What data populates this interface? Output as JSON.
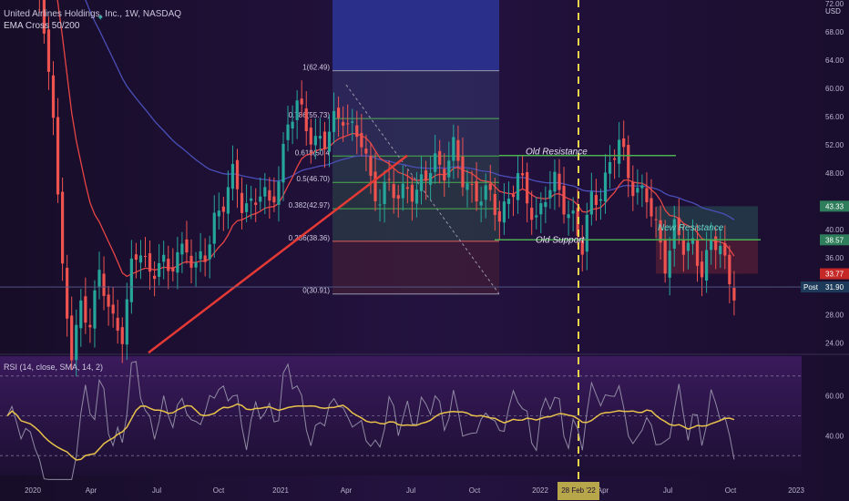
{
  "header": {
    "symbol": "United Airlines Holdings, Inc., 1W, NASDAQ",
    "indicator": "EMA Cross 50/200",
    "currency": "USD"
  },
  "rsi_label": "RSI (14, close, SMA, 14, 2)",
  "colors": {
    "background": "#1b0f30",
    "up": "#26a69a",
    "down": "#ef5350",
    "ema50": "#e84545",
    "ema200": "#4a4fb8",
    "rsi": "#8f8aa3",
    "rsi_ma": "#e8c24a",
    "fib_green": "#4caf50",
    "trend": "#e53935",
    "dashed": "#e8d44a"
  },
  "chart_data": [
    {
      "type": "candlestick",
      "title": "United Airlines Holdings, Inc., 1W, NASDAQ",
      "x_ticks": [
        "2020",
        "Apr",
        "Jul",
        "Oct",
        "2021",
        "Apr",
        "Jul",
        "Oct",
        "2022",
        "Apr",
        "Jul",
        "Oct",
        "2023"
      ],
      "y_ticks": [
        24.0,
        28.0,
        31.9,
        36.0,
        40.0,
        48.0,
        52.0,
        56.0,
        60.0,
        64.0,
        68.0,
        72.0
      ],
      "y_range": [
        22.5,
        72.5
      ],
      "grid": false,
      "fib_levels": [
        {
          "ratio": "1",
          "value": 62.49
        },
        {
          "ratio": "0.786",
          "value": 55.73
        },
        {
          "ratio": "0.618",
          "value": 50.43
        },
        {
          "ratio": "0.5",
          "value": 46.7
        },
        {
          "ratio": "0.382",
          "value": 42.97
        },
        {
          "ratio": "0.236",
          "value": 38.36
        },
        {
          "ratio": "0",
          "value": 30.91
        }
      ],
      "fib_labels": [
        "1(62.49)",
        "0.786(55.73)",
        "0.618(50.4",
        "0.5(46.70)",
        "0.382(42.97)",
        "0.236(38.36)",
        "0(30.91)"
      ],
      "annotations": [
        "Old Resistance",
        "Old Support",
        "New Resistance"
      ],
      "event_marker": "28 Feb '22",
      "price_labels": [
        {
          "label": "",
          "value": "43.33"
        },
        {
          "label": "",
          "value": "38.57"
        },
        {
          "label": "",
          "value": "33.77"
        },
        {
          "label": "Post",
          "value": "31.90"
        },
        {
          "label": "",
          "value": "31.90"
        }
      ]
    },
    {
      "type": "line",
      "title": "RSI (14, close, SMA, 14, 2)",
      "y_ticks": [
        40.0,
        60.0
      ],
      "y_range": [
        20,
        80
      ],
      "series": [
        "RSI",
        "SMA"
      ]
    }
  ]
}
